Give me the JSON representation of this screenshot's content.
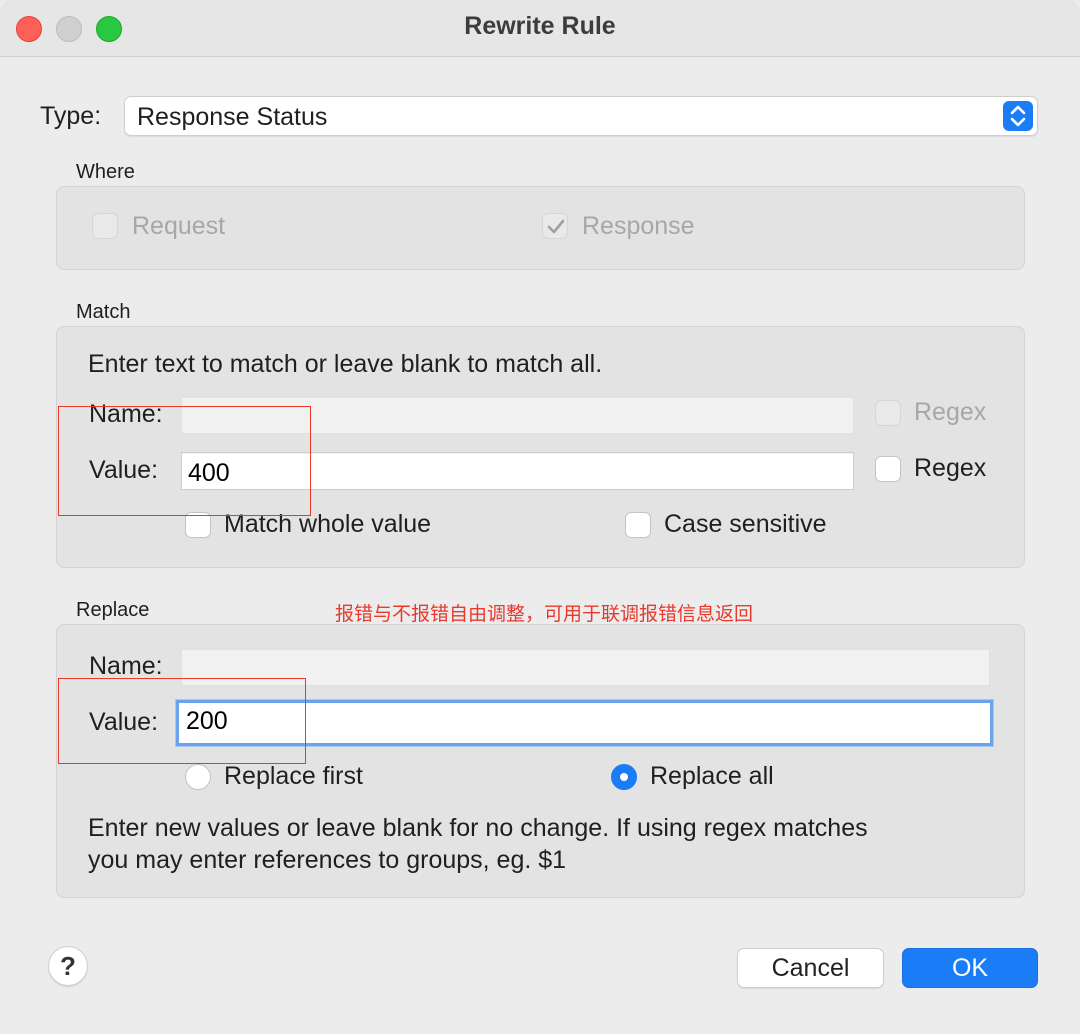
{
  "window": {
    "title": "Rewrite Rule"
  },
  "type": {
    "label": "Type:",
    "selected": "Response Status"
  },
  "where": {
    "title": "Where",
    "request_label": "Request",
    "request_checked": false,
    "response_label": "Response",
    "response_checked": true
  },
  "match": {
    "title": "Match",
    "instructions": "Enter text to match or leave blank to match all.",
    "name_label": "Name:",
    "name_value": "",
    "name_regex_label": "Regex",
    "value_label": "Value:",
    "value_value": "400",
    "value_regex_label": "Regex",
    "match_whole_label": "Match whole value",
    "case_sensitive_label": "Case sensitive"
  },
  "replace": {
    "title": "Replace",
    "annotation": "报错与不报错自由调整，可用于联调报错信息返回",
    "name_label": "Name:",
    "name_value": "",
    "value_label": "Value:",
    "value_value": "200",
    "replace_first_label": "Replace first",
    "replace_all_label": "Replace all",
    "selected_mode": "Replace all",
    "help_line1": "Enter new values or leave blank for no change. If using regex matches",
    "help_line2": "you may enter references to groups, eg. $1"
  },
  "footer": {
    "help_label": "?",
    "cancel_label": "Cancel",
    "ok_label": "OK"
  },
  "colors": {
    "accent": "#1a7cf7",
    "annotation": "#e8392d"
  }
}
